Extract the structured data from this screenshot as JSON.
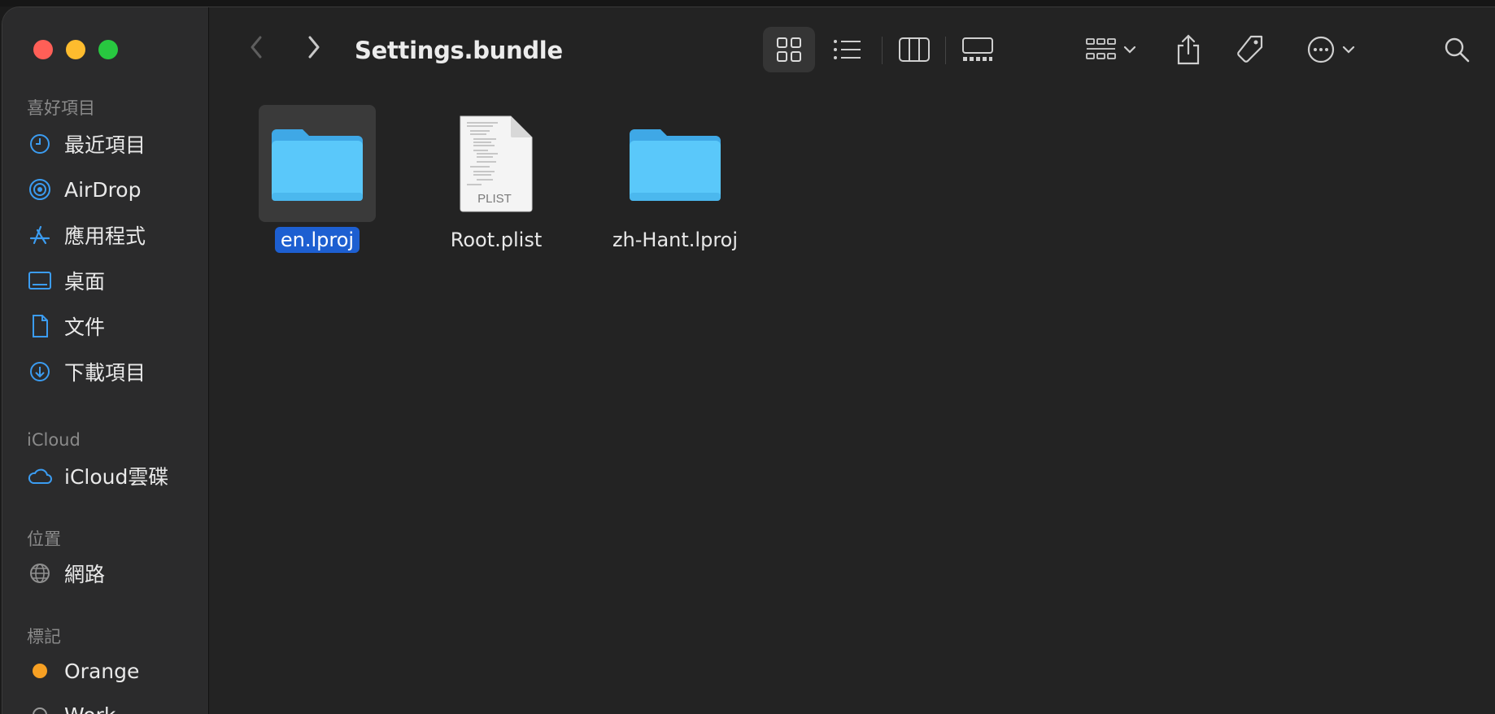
{
  "window": {
    "title": "Settings.bundle"
  },
  "colors": {
    "accent": "#1d5fd1",
    "folder": "#5ac8fa",
    "sidebar_icon": "#3b9cf1"
  },
  "sidebar": {
    "sections": [
      {
        "title": "喜好項目",
        "items": [
          {
            "label": "最近項目",
            "icon": "clock-icon"
          },
          {
            "label": "AirDrop",
            "icon": "airdrop-icon"
          },
          {
            "label": "應用程式",
            "icon": "apps-icon"
          },
          {
            "label": "桌面",
            "icon": "desktop-icon"
          },
          {
            "label": "文件",
            "icon": "document-icon"
          },
          {
            "label": "下載項目",
            "icon": "download-icon"
          }
        ]
      },
      {
        "title": "iCloud",
        "items": [
          {
            "label": "iCloud雲碟",
            "icon": "cloud-icon"
          }
        ]
      },
      {
        "title": "位置",
        "items": [
          {
            "label": "網路",
            "icon": "globe-icon"
          }
        ]
      },
      {
        "title": "標記",
        "items": [
          {
            "label": "Orange",
            "icon": "orange-tag-icon"
          },
          {
            "label": "Work",
            "icon": "tag-circle-icon"
          }
        ]
      }
    ]
  },
  "files": [
    {
      "name": "en.lproj",
      "kind": "folder",
      "selected": true
    },
    {
      "name": "Root.plist",
      "kind": "plist",
      "badge": "PLIST",
      "selected": false
    },
    {
      "name": "zh-Hant.lproj",
      "kind": "folder",
      "selected": false
    }
  ]
}
